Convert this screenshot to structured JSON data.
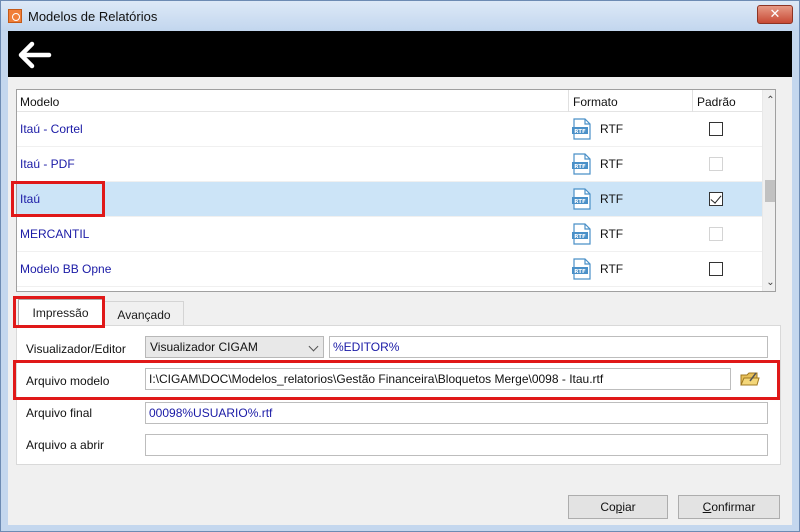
{
  "window": {
    "title": "Modelos de Relatórios",
    "close_label": "✕"
  },
  "toolbar": {
    "back_icon": "back-arrow-icon"
  },
  "grid": {
    "columns": {
      "modelo": "Modelo",
      "formato": "Formato",
      "padrao": "Padrão"
    },
    "rows": [
      {
        "name": "Itaú - Cortel",
        "format": "RTF",
        "padrao": "unchecked"
      },
      {
        "name": "Itaú - PDF",
        "format": "RTF",
        "padrao": "disabled"
      },
      {
        "name": "Itaú",
        "format": "RTF",
        "padrao": "checked",
        "selected": true
      },
      {
        "name": "MERCANTIL",
        "format": "RTF",
        "padrao": "disabled"
      },
      {
        "name": "Modelo BB Opne",
        "format": "RTF",
        "padrao": "unchecked"
      }
    ]
  },
  "tabs": {
    "impressao": "Impressão",
    "avancado": "Avançado",
    "active": "impressao"
  },
  "form": {
    "visualizador_label": "Visualizador/Editor",
    "visualizador_value": "Visualizador CIGAM",
    "editor_value": "%EDITOR%",
    "arquivo_modelo_label": "Arquivo modelo",
    "arquivo_modelo_value": "I:\\CIGAM\\DOC\\Modelos_relatorios\\Gestão Financeira\\Bloquetos Merge\\0098 - Itau.rtf",
    "arquivo_final_label": "Arquivo final",
    "arquivo_final_value": "00098%USUARIO%.rtf",
    "arquivo_abrir_label": "Arquivo a abrir",
    "arquivo_abrir_value": ""
  },
  "buttons": {
    "copiar_first": "Co",
    "copiar_ul": "p",
    "copiar_rest": "iar",
    "confirmar_ul": "C",
    "confirmar_rest": "onfirmar"
  },
  "colors": {
    "highlight": "#e01818",
    "selected_row": "#cce4f7",
    "link_text": "#1a1aa6"
  }
}
